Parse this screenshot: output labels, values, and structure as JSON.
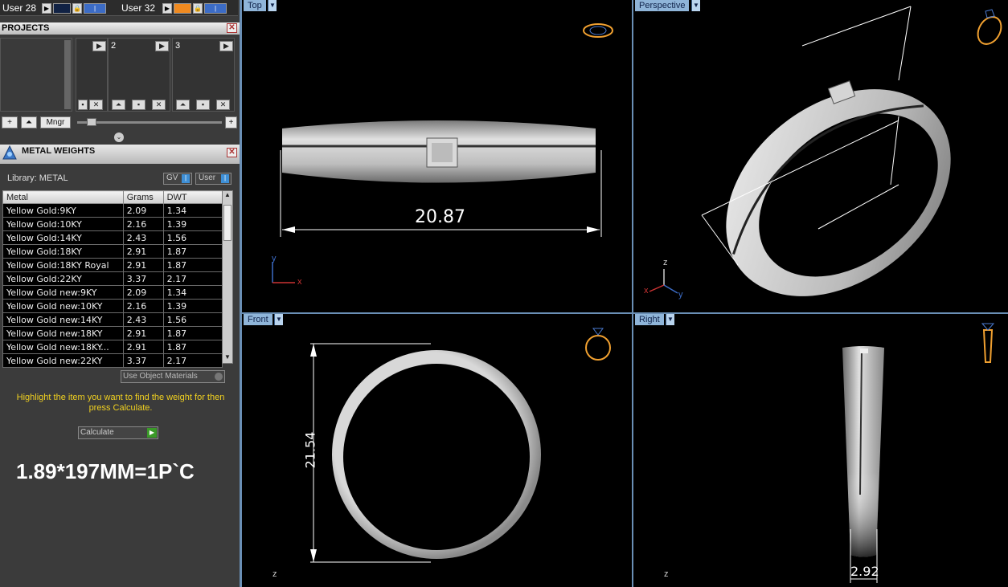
{
  "users": [
    {
      "label": "User 28"
    },
    {
      "label": "User 32"
    }
  ],
  "projects": {
    "title": "PROJECTS",
    "slots": [
      "2",
      "3"
    ],
    "mngr_label": "Mngr"
  },
  "metal_weights": {
    "title": "METAL WEIGHTS",
    "library_label": "Library: METAL",
    "gv_label": "GV",
    "user_label": "User",
    "columns": [
      "Metal",
      "Grams",
      "DWT"
    ],
    "rows": [
      [
        "Yellow Gold:9KY",
        "2.09",
        "1.34"
      ],
      [
        "Yellow Gold:10KY",
        "2.16",
        "1.39"
      ],
      [
        "Yellow Gold:14KY",
        "2.43",
        "1.56"
      ],
      [
        "Yellow Gold:18KY",
        "2.91",
        "1.87"
      ],
      [
        "Yellow Gold:18KY Royal",
        "2.91",
        "1.87"
      ],
      [
        "Yellow Gold:22KY",
        "3.37",
        "2.17"
      ],
      [
        "Yellow Gold new:9KY",
        "2.09",
        "1.34"
      ],
      [
        "Yellow Gold new:10KY",
        "2.16",
        "1.39"
      ],
      [
        "Yellow Gold new:14KY",
        "2.43",
        "1.56"
      ],
      [
        "Yellow Gold new:18KY",
        "2.91",
        "1.87"
      ],
      [
        "Yellow Gold new:18KY...",
        "2.91",
        "1.87"
      ],
      [
        "Yellow Gold new:22KY",
        "3.37",
        "2.17"
      ]
    ],
    "use_object_materials": "Use Object Materials",
    "instructions": "Highlight the item you want to find the weight for then press Calculate.",
    "calculate_label": "Calculate",
    "note": "1.89*197MM=1P`C"
  },
  "viewports": {
    "top": {
      "label": "Top",
      "dimension": "20.87",
      "axis_y": "y",
      "axis_x": "x"
    },
    "perspective": {
      "label": "Perspective",
      "axis_z": "z",
      "axis_x": "x",
      "axis_y": "y"
    },
    "front": {
      "label": "Front",
      "dimension": "21.54",
      "axis_z": "z"
    },
    "right": {
      "label": "Right",
      "dimension": "2.92",
      "axis_z": "z"
    }
  },
  "colors": {
    "accent": "#8fb5d9",
    "dimension_line": "#ffffff",
    "ring_icon": "#f0a030",
    "warning_text": "#f0d020"
  }
}
